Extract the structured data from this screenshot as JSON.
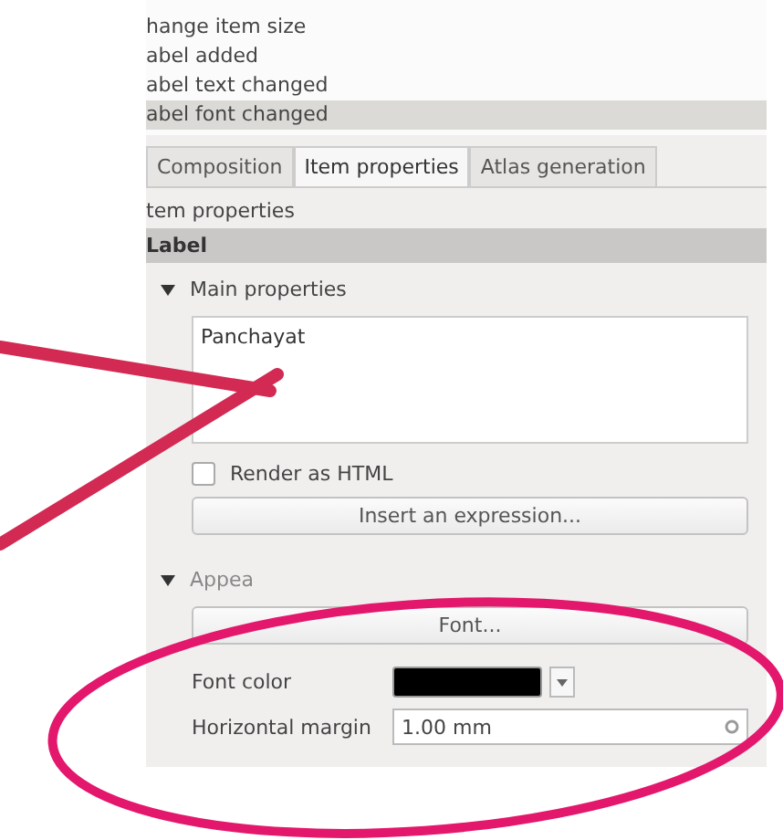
{
  "undo_history": [
    {
      "text": "hange item size",
      "selected": false
    },
    {
      "text": "abel added",
      "selected": false
    },
    {
      "text": "abel text changed",
      "selected": false
    },
    {
      "text": "abel font changed",
      "selected": true
    }
  ],
  "tabs": [
    {
      "label": "Composition",
      "selected": false
    },
    {
      "label": "Item properties",
      "selected": true
    },
    {
      "label": "Atlas generation",
      "selected": false
    }
  ],
  "panel_title": "tem properties",
  "item_header": "Label",
  "main_properties": {
    "title": "Main properties",
    "expanded": true,
    "text": "Panchayat",
    "render_as_html": {
      "label": "Render as HTML",
      "checked": false
    },
    "expression_button": "Insert an expression..."
  },
  "appearance": {
    "title": "Appea",
    "expanded": true,
    "font_button": "Font...",
    "font_color": {
      "label": "Font color",
      "color": "#000000"
    },
    "horizontal_margin": {
      "label": "Horizontal margin",
      "value": "1.00 mm"
    }
  }
}
